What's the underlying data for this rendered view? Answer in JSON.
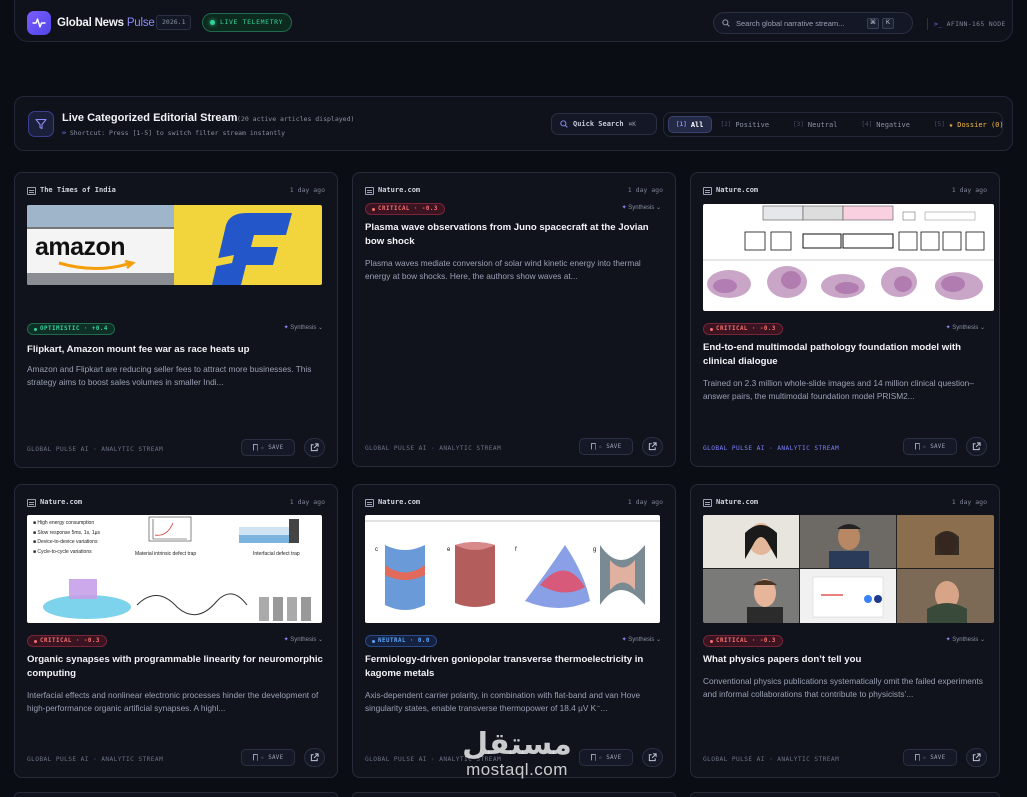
{
  "header": {
    "app_name": "Global News",
    "app_name_accent": "Pulse",
    "version": "2026.1",
    "telemetry": "LIVE TELEMETRY",
    "search_placeholder": "Search global narrative stream...",
    "search_kbd1": "⌘",
    "search_kbd2": "K",
    "node": "AFINN-165 NODE"
  },
  "filterbar": {
    "title": "Live Categorized Editorial Stream",
    "count": "(20 active articles displayed)",
    "shortcut": "Shortcut: Press [1-5] to switch filter stream instantly",
    "quick_search": "Quick Search",
    "quick_search_kbd": "⌘K",
    "tabs": [
      {
        "num": "[1]",
        "label": "All"
      },
      {
        "num": "[2]",
        "label": "Positive"
      },
      {
        "num": "[3]",
        "label": "Neutral"
      },
      {
        "num": "[4]",
        "label": "Negative"
      },
      {
        "num": "[5]",
        "label": "★ Dossier (0)"
      }
    ]
  },
  "cards": [
    {
      "source": "The Times of India",
      "age": "1 day ago",
      "badge": "OPTIMISTIC · +0.4",
      "synth": "Synthesis",
      "title": "Flipkart, Amazon mount fee war as race heats up",
      "body": "Amazon and Flipkart are reducing seller fees to attract more businesses. This strategy aims to boost sales volumes in smaller Indi...",
      "footer": "GLOBAL PULSE AI · ANALYTIC STREAM",
      "save": "☆ SAVE",
      "image_text": "amazon"
    },
    {
      "source": "Nature.com",
      "age": "1 day ago",
      "badge": "CRITICAL · -0.3",
      "synth": "Synthesis",
      "title": "Plasma wave observations from Juno spacecraft at the Jovian bow shock",
      "body": "Plasma waves mediate conversion of solar wind kinetic energy into thermal energy at bow shocks. Here, the authors show waves at...",
      "footer": "GLOBAL PULSE AI · ANALYTIC STREAM",
      "save": "☆ SAVE"
    },
    {
      "source": "Nature.com",
      "age": "1 day ago",
      "badge": "CRITICAL · -0.3",
      "synth": "Synthesis",
      "title": "End-to-end multimodal pathology foundation model with clinical dialogue",
      "body": "Trained on 2.3 million whole-slide images and 14 million clinical question–answer pairs, the multimodal foundation model PRISM2...",
      "footer": "GLOBAL PULSE AI · ANALYTIC STREAM",
      "save": "☆ SAVE"
    },
    {
      "source": "Nature.com",
      "age": "1 day ago",
      "badge": "CRITICAL · -0.3",
      "synth": "Synthesis",
      "title": "Organic synapses with programmable linearity for neuromorphic computing",
      "body": "Interfacial effects and nonlinear electronic processes hinder the development of high-performance organic artificial synapses. A highl...",
      "footer": "GLOBAL PULSE AI · ANALYTIC STREAM",
      "save": "☆ SAVE",
      "image_lines": [
        "High energy consumption",
        "Slow response 5ms, 1s, 1µs",
        "Device-to-device variations",
        "Cycle-to-cycle variations",
        "Material intrinsic defect trap",
        "Interfacial defect trap"
      ]
    },
    {
      "source": "Nature.com",
      "age": "1 day ago",
      "badge": "NEUTRAL · 0.0",
      "synth": "Synthesis",
      "title": "Fermiology-driven goniopolar transverse thermoelectricity in kagome metals",
      "body": "Axis-dependent carrier polarity, in combination with flat-band and van Hove singularity states, enable transverse thermopower of 18.4 µV K⁻...",
      "footer": "GLOBAL PULSE AI · ANALYTIC STREAM",
      "save": "☆ SAVE"
    },
    {
      "source": "Nature.com",
      "age": "1 day ago",
      "badge": "CRITICAL · -0.3",
      "synth": "Synthesis",
      "title": "What physics papers don’t tell you",
      "body": "Conventional physics publications systematically omit the failed experiments and informal collaborations that contribute to physicists’...",
      "footer": "GLOBAL PULSE AI · ANALYTIC STREAM",
      "save": "☆ SAVE"
    }
  ],
  "watermark": {
    "arabic": "مستقل",
    "latin": "mostaql.com"
  }
}
